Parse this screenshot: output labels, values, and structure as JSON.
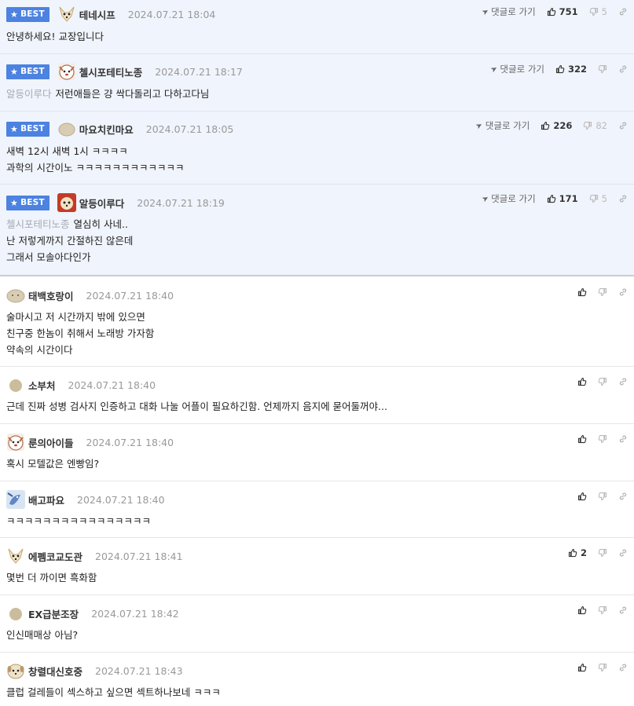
{
  "labels": {
    "best": "BEST",
    "reply_to": "댓글로 가기"
  },
  "colors": {
    "best_badge": "#4c82e0",
    "best_row_bg": "#f0f4fc",
    "mention": "#a5aab3"
  },
  "best_comments": [
    {
      "nickname": "테네시프",
      "avatar": "chihuahua-avatar",
      "date": "2024.07.21 18:04",
      "upvotes": "751",
      "downvotes": "5",
      "mention": "",
      "lines": [
        "안녕하세요! 교장입니다"
      ]
    },
    {
      "nickname": "첼시포테티노종",
      "avatar": "dog-avatar",
      "date": "2024.07.21 18:17",
      "upvotes": "322",
      "downvotes": "",
      "mention": "알등이루다",
      "lines": [
        "저런애들은 걍 싹다돌리고 다하고다님"
      ]
    },
    {
      "nickname": "마요치킨마요",
      "avatar": "beige-blob-avatar",
      "date": "2024.07.21 18:05",
      "upvotes": "226",
      "downvotes": "82",
      "mention": "",
      "lines": [
        "새벽 12시 새벽 1시 ㅋㅋㅋㅋ",
        "과학의 시간이노 ㅋㅋㅋㅋㅋㅋㅋㅋㅋㅋㅋㅋ"
      ]
    },
    {
      "nickname": "알등이루다",
      "avatar": "red-panda-avatar",
      "date": "2024.07.21 18:19",
      "upvotes": "171",
      "downvotes": "5",
      "mention": "첼시포테티노종",
      "lines": [
        "열심히 사네..",
        "난 저렇게까지 간절하진 않은데",
        "그래서 모솔아다인가"
      ]
    }
  ],
  "comments": [
    {
      "nickname": "태백호랑이",
      "avatar": "beige-blob-avatar",
      "date": "2024.07.21 18:40",
      "upvotes": "",
      "lines": [
        "술마시고 저 시간까지 밖에 있으면",
        "친구중 한놈이 취해서 노래방 가자함",
        "약속의 시간이다"
      ]
    },
    {
      "nickname": "소부처",
      "avatar": "beige-circle-avatar",
      "date": "2024.07.21 18:40",
      "upvotes": "",
      "lines": [
        "근데 진짜 성병 검사지 인증하고 대화 나눌 어플이 필요하긴함. 언제까지 음지에 묻어둘꺼야..."
      ]
    },
    {
      "nickname": "룬의아이들",
      "avatar": "dog-avatar",
      "date": "2024.07.21 18:40",
      "upvotes": "",
      "lines": [
        "혹시 모텔값은 엔빵임?"
      ]
    },
    {
      "nickname": "배고파요",
      "avatar": "blue-bird-avatar",
      "date": "2024.07.21 18:40",
      "upvotes": "",
      "lines": [
        "ㅋㅋㅋㅋㅋㅋㅋㅋㅋㅋㅋㅋㅋㅋㅋㅋ"
      ]
    },
    {
      "nickname": "에펨코교도관",
      "avatar": "chihuahua-avatar",
      "date": "2024.07.21 18:41",
      "upvotes": "2",
      "lines": [
        "몇번 더 까이면 흑화함"
      ]
    },
    {
      "nickname": "EX급분조장",
      "avatar": "beige-circle-avatar",
      "date": "2024.07.21 18:42",
      "upvotes": "",
      "lines": [
        "인신매매상 아님?"
      ]
    },
    {
      "nickname": "창렬대신호중",
      "avatar": "puppy-avatar",
      "date": "2024.07.21 18:43",
      "upvotes": "",
      "lines": [
        "클럽 걸레들이 섹스하고 싶으면 섹트하나보네 ㅋㅋㅋ"
      ]
    }
  ]
}
